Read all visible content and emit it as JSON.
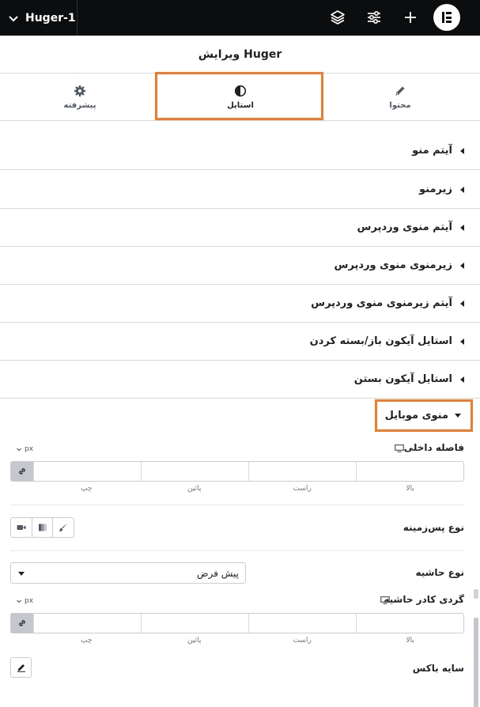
{
  "topbar": {
    "document_name": "Huger-1"
  },
  "panel": {
    "title": "ویرایش Huger"
  },
  "tabs": [
    {
      "label": "پیشرفته",
      "icon": "gear-icon"
    },
    {
      "label": "استایل",
      "icon": "half-circle-icon"
    },
    {
      "label": "محتوا",
      "icon": "pencil-icon"
    }
  ],
  "sections": [
    "آیتم منو",
    "زیرمنو",
    "آیتم منوی وردپرس",
    "زیرمنوی منوی وردپرس",
    "آیتم زیرمنوی منوی وردپرس",
    "استایل آیکون باز/بسته کردن",
    "استایل آیکون بستن"
  ],
  "open_section": "منوی موبایل",
  "controls": {
    "padding": {
      "label": "فاصله داخلی",
      "unit": "px",
      "dims": [
        "چپ",
        "پائین",
        "راست",
        "بالا"
      ]
    },
    "background_type": {
      "label": "نوع پس‌زمینه"
    },
    "border_type": {
      "label": "نوع حاشیه",
      "value": "پیش فرض"
    },
    "border_radius": {
      "label": "گردی کادر حاشیه",
      "unit": "px",
      "dims": [
        "چپ",
        "پائین",
        "راست",
        "بالا"
      ]
    },
    "box_shadow": {
      "label": "سایه باکس"
    }
  },
  "colors": {
    "accent_highlight": "#f07b2b",
    "topbar": "#0c0d0e",
    "link_active": "#c4c8cd"
  }
}
